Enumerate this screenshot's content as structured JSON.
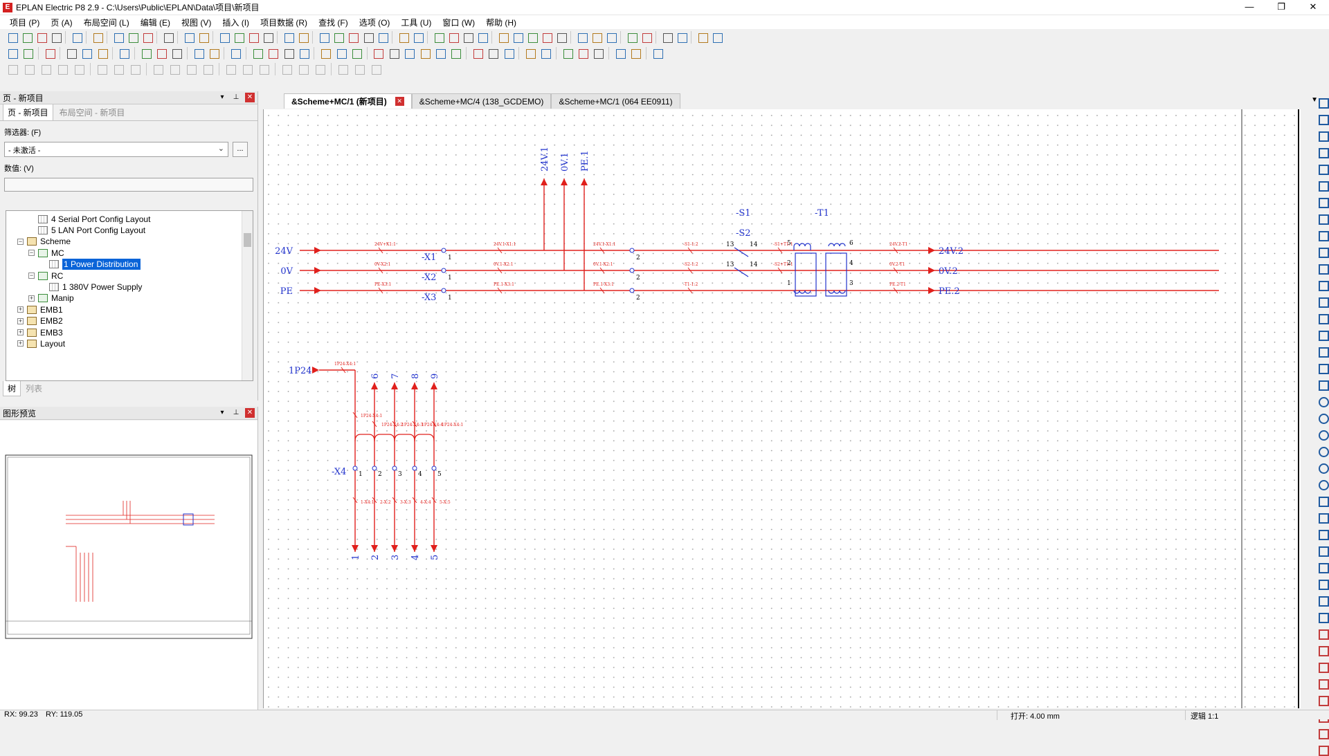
{
  "window": {
    "title": "EPLAN Electric P8 2.9 - C:\\Users\\Public\\EPLAN\\Data\\项目\\新项目",
    "app_icon": "eplan-logo-icon",
    "buttons": {
      "minimize": "—",
      "maximize": "❐",
      "close": "✕"
    }
  },
  "menubar": {
    "items": [
      "项目 (P)",
      "页 (A)",
      "布局空间 (L)",
      "编辑 (E)",
      "视图 (V)",
      "插入 (I)",
      "项目数据 (R)",
      "查找 (F)",
      "选项 (O)",
      "工具 (U)",
      "窗口 (W)",
      "帮助 (H)"
    ]
  },
  "pages_pane": {
    "title": "页 - 新项目",
    "tabs": [
      "页 - 新项目",
      "布局空间 - 新项目"
    ],
    "filter_label": "筛选器: (F)",
    "filter_value": "- 未激活 -",
    "filter_more": "...",
    "value_label": "数值: (V)",
    "tree": [
      {
        "label": "4 Serial Port Config Layout",
        "type": "page"
      },
      {
        "label": "5 LAN Port Config Layout",
        "type": "page"
      },
      {
        "label": "Scheme",
        "type": "folder",
        "expander": "−"
      },
      {
        "label": "MC",
        "type": "struct",
        "expander": "−"
      },
      {
        "label": "1 Power Distribution",
        "type": "page",
        "selected": true
      },
      {
        "label": "RC",
        "type": "struct",
        "expander": "−"
      },
      {
        "label": "1 380V Power Supply",
        "type": "page"
      },
      {
        "label": "Manip",
        "type": "struct",
        "expander": "+"
      },
      {
        "label": "EMB1",
        "type": "folder",
        "expander": "+"
      },
      {
        "label": "EMB2",
        "type": "folder",
        "expander": "+"
      },
      {
        "label": "EMB3",
        "type": "folder",
        "expander": "+"
      },
      {
        "label": "Layout",
        "type": "folder",
        "expander": "+"
      }
    ],
    "bottom_tabs": [
      "树",
      "列表"
    ]
  },
  "preview_pane": {
    "title": "图形预览"
  },
  "doc_tabs": [
    {
      "label": "&Scheme+MC/1 (新项目)",
      "active": true,
      "close": "✕"
    },
    {
      "label": "&Scheme+MC/4 (138_GCDEMO)",
      "active": false
    },
    {
      "label": "&Scheme+MC/1 (064 EE0911)",
      "active": false
    }
  ],
  "tab_overflow": "▼",
  "schematic": {
    "colors": {
      "wire": "#e0201c",
      "symbol": "#2233cc",
      "grid": "#9a9a9a"
    },
    "top_potentials": [
      "24V.1",
      "0V.1",
      "PE.1"
    ],
    "left_potentials": [
      "24V",
      "0V",
      "PE"
    ],
    "right_potentials": [
      "24V.2",
      "0V.2",
      "PE.2"
    ],
    "terminal_labels": [
      "-X1",
      "-X2",
      "-X3"
    ],
    "terminal_pins": [
      "1",
      "1",
      "1",
      "2",
      "2",
      "2"
    ],
    "switches": [
      "-S1",
      "-S2"
    ],
    "switch_pins": [
      "13",
      "14",
      "13",
      "14"
    ],
    "transformer": "-T1",
    "transformer_pins": [
      "5",
      "2",
      "1",
      "6",
      "4",
      "3"
    ],
    "wire_tags_row1": [
      "24V+X1:1",
      "24V.1-X1:1",
      "24V.1-X1:1",
      "-S1-1:2",
      "-S1+T1:1",
      "24V.2-T1"
    ],
    "wire_tags_row2": [
      "0V-X2:1",
      "0V.1-X2:1",
      "0V.1-X2:1",
      "-S2-1:2",
      "-S2+T1:1",
      "0V.2-T1"
    ],
    "wire_tags_row3": [
      "PE-X3:1",
      "PE.1-X3:1",
      "PE.1-X3:1",
      "-T1-1:2",
      "PE.2-T1"
    ],
    "p24_label": "1P24",
    "p24_tag": "1P24-X4:1",
    "x4_label": "-X4",
    "x4_top_numbers": [
      "6",
      "7",
      "8",
      "9"
    ],
    "x4_pins": [
      "1",
      "2",
      "3",
      "4",
      "5"
    ],
    "x4_bottom_numbers": [
      "1",
      "2",
      "3",
      "4",
      "5"
    ],
    "x4_tags_top": [
      "1P24-X4:1",
      "1P24-X4:2",
      "1P24-X4:3",
      "1P24-X4:4",
      "1P24-X4:1"
    ],
    "x4_tags_bottom": [
      "1-X4:1",
      "2-X:2",
      "3-X:3",
      "4-X:4",
      "5-X:5"
    ]
  },
  "statusbar": {
    "rx": "RX: 99.23",
    "ry": "RY: 119.05",
    "snap": "打开: 4.00 mm",
    "logic": "逻辑 1:1"
  }
}
